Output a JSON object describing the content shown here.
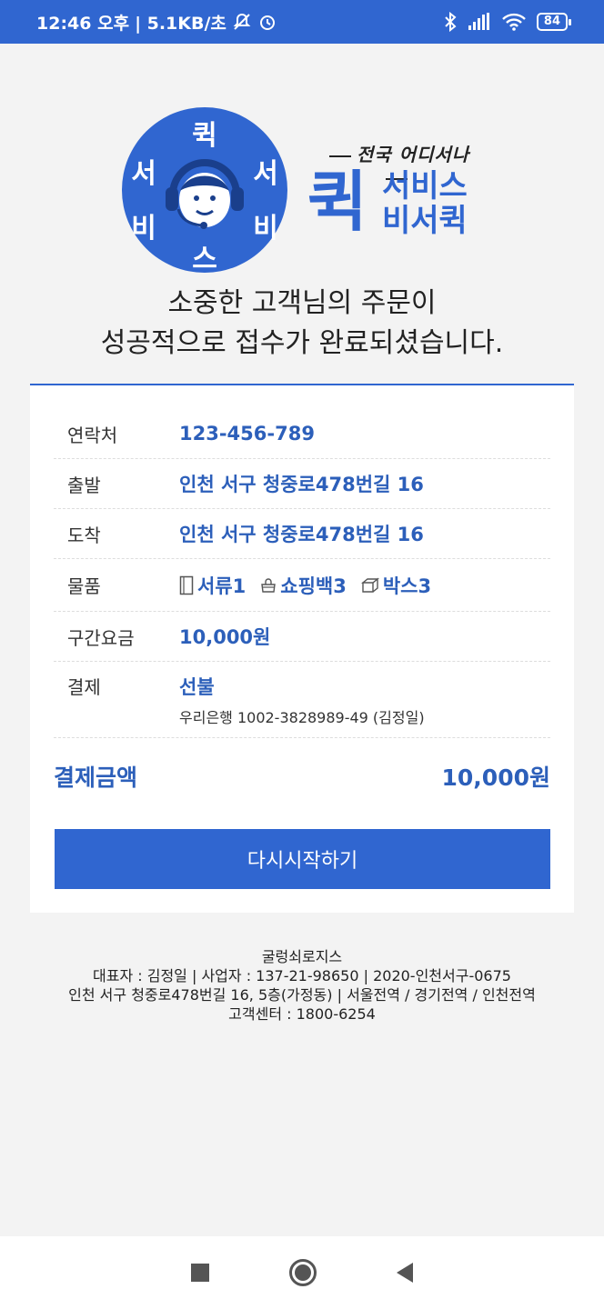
{
  "status_bar": {
    "time": "12:46 오후",
    "net_speed": "| 5.1KB/초",
    "battery": "84",
    "icons": [
      "mute-bell-icon",
      "alarm-icon",
      "bluetooth-icon",
      "signal-icon",
      "wifi-icon",
      "battery-icon"
    ]
  },
  "logo": {
    "circle_chars": {
      "top": "퀵",
      "left_top": "서",
      "right_top": "서",
      "left_bottom": "비",
      "right_bottom": "비",
      "bottom": "스"
    },
    "slogan": "전국 어디서나",
    "big_char": "퀵",
    "line1": "서비스",
    "line2": "비서퀵"
  },
  "headline": {
    "line1": "소중한 고객님의 주문이",
    "line2": "성공적으로 접수가 완료되셨습니다."
  },
  "order": {
    "contact_label": "연락처",
    "contact_value": "123-456-789",
    "departure_label": "출발",
    "departure_value": "인천 서구 청중로478번길 16",
    "arrival_label": "도착",
    "arrival_value": "인천 서구 청중로478번길 16",
    "items_label": "물품",
    "items": [
      {
        "icon": "document-icon",
        "text": "서류1"
      },
      {
        "icon": "shopping-bag-icon",
        "text": "쇼핑백3"
      },
      {
        "icon": "box-icon",
        "text": "박스3"
      }
    ],
    "fare_label": "구간요금",
    "fare_value": "10,000원",
    "payment_label": "결제",
    "payment_value": "선불",
    "payment_account": "우리은행 1002-3828989-49 (김정일)"
  },
  "total": {
    "label": "결제금액",
    "value": "10,000원"
  },
  "restart_button": "다시시작하기",
  "footer": {
    "company": "굴렁쇠로지스",
    "line1": "대표자 : 김정일  |  사업자 : 137-21-98650  |  2020-인천서구-0675",
    "line2": "인천 서구 청중로478번길 16, 5층(가정동)  |  서울전역 / 경기전역 / 인천전역",
    "line3": "고객센터 : 1800-6254"
  },
  "colors": {
    "accent": "#3066d0",
    "value_text": "#2c5fba"
  }
}
